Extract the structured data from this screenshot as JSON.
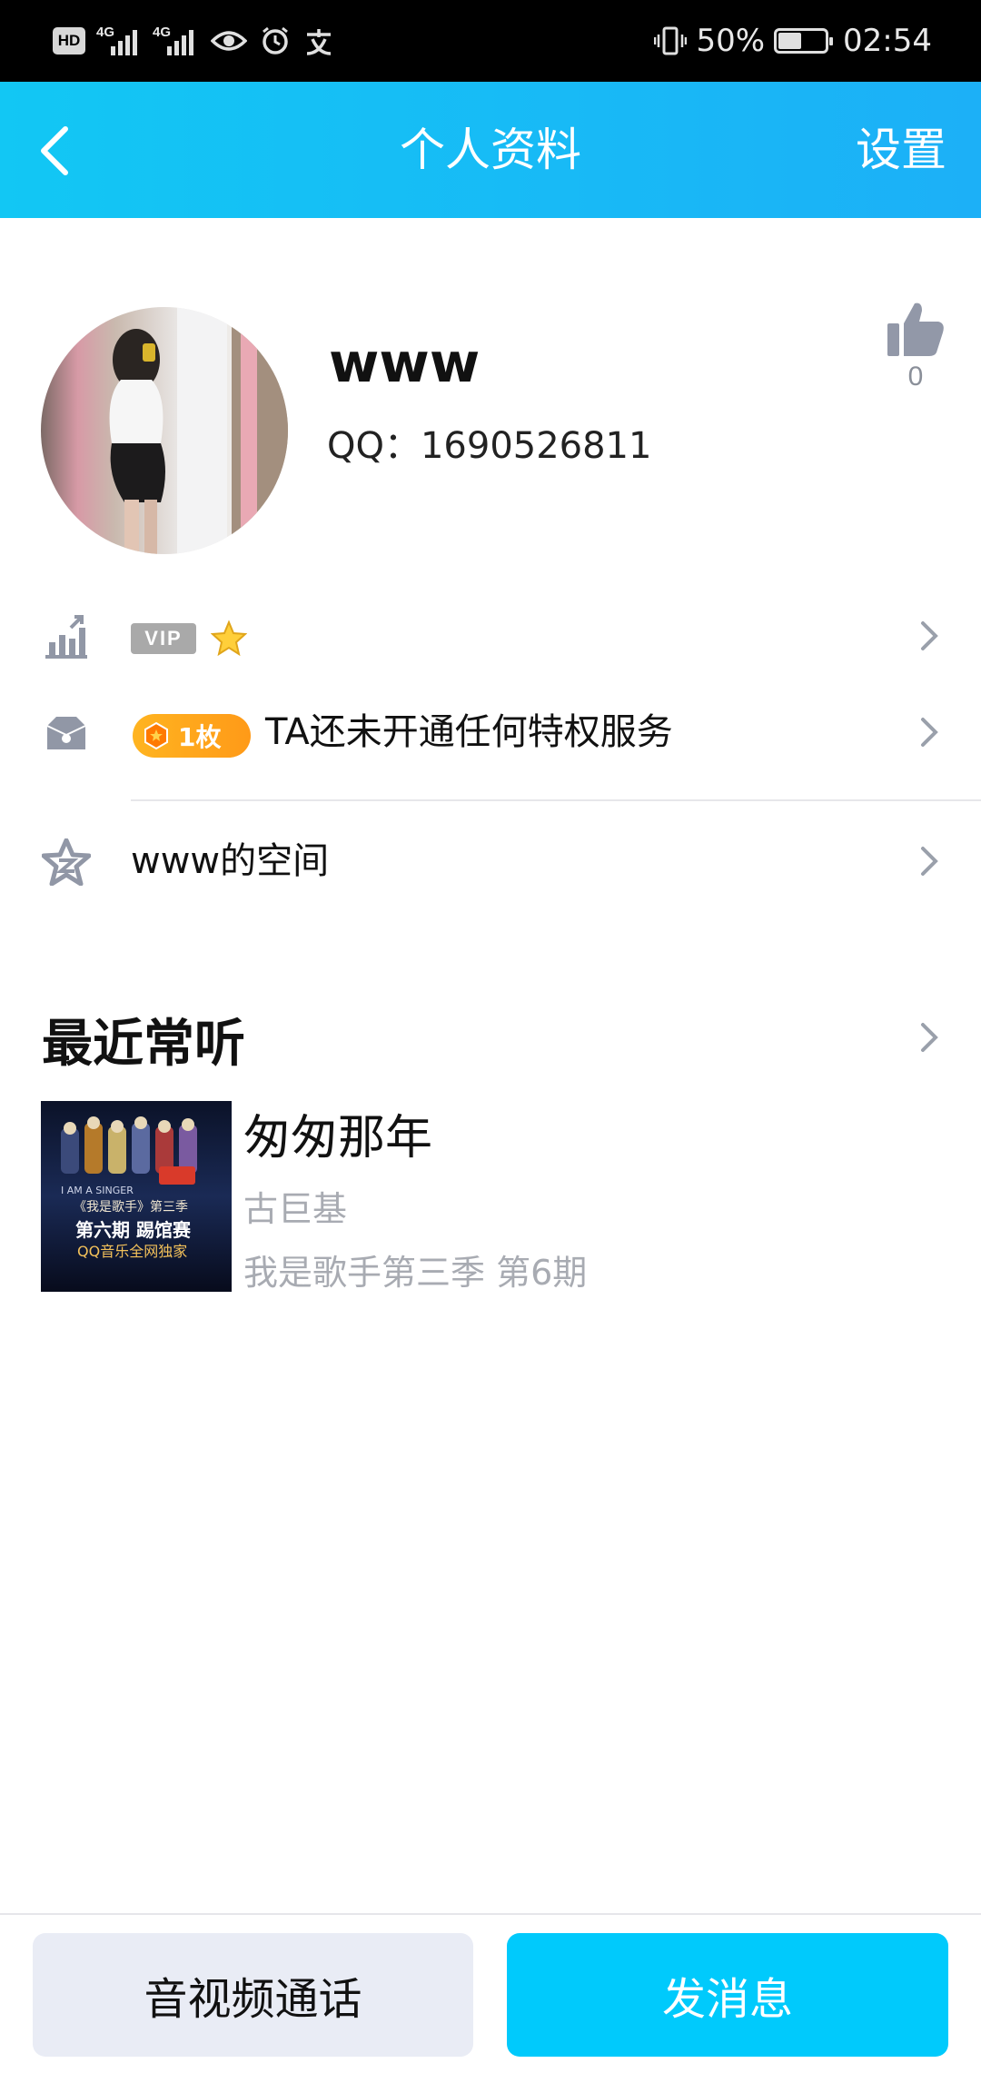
{
  "status_bar": {
    "hd": "HD",
    "sim1": "4G",
    "sim2": "4G",
    "battery": "50%",
    "battery_level": 0.5,
    "time": "02:54"
  },
  "header": {
    "title": "个人资料",
    "settings": "设置"
  },
  "profile": {
    "name": "www",
    "qq": "QQ：1690526811",
    "likes": "0"
  },
  "rows": {
    "vip_label": "VIP",
    "medal_count": "1枚",
    "privilege_text": "TA还未开通任何特权服务",
    "space_text": "www的空间"
  },
  "recent": {
    "title": "最近常听",
    "song": {
      "title": "匆匆那年",
      "artist": "古巨基",
      "album": "我是歌手第三季 第6期"
    },
    "cover_lines": [
      "I AM A SINGER",
      "《我是歌手》第三季",
      "第六期 踢馆赛",
      "QQ音乐全网独家"
    ]
  },
  "buttons": {
    "call": "音视频通话",
    "message": "发消息"
  },
  "colors": {
    "header_start": "#12c7f4",
    "header_end": "#1cb0f7",
    "message_button": "#00cafc",
    "call_button": "#e9ecf5",
    "medal_badge": "#ffa81c"
  }
}
